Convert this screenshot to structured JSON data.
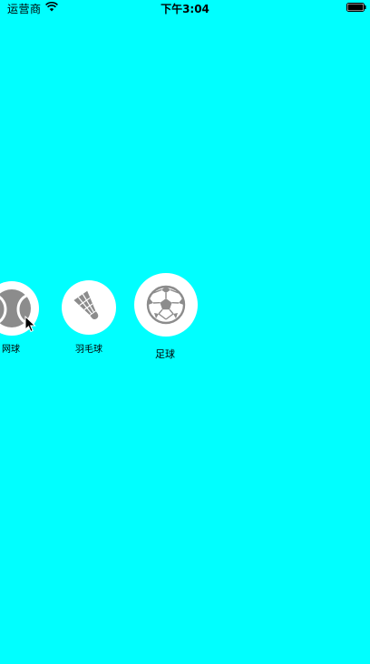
{
  "status_bar": {
    "carrier": "运营商",
    "time": "下午3:04",
    "wifi_icon": "wifi-icon",
    "battery_icon": "battery-icon"
  },
  "background_color": "#00FFFF",
  "sports": [
    {
      "label": "网球",
      "icon": "tennis-ball-icon"
    },
    {
      "label": "羽毛球",
      "icon": "shuttlecock-icon"
    },
    {
      "label": "足球",
      "icon": "soccer-ball-icon"
    }
  ]
}
